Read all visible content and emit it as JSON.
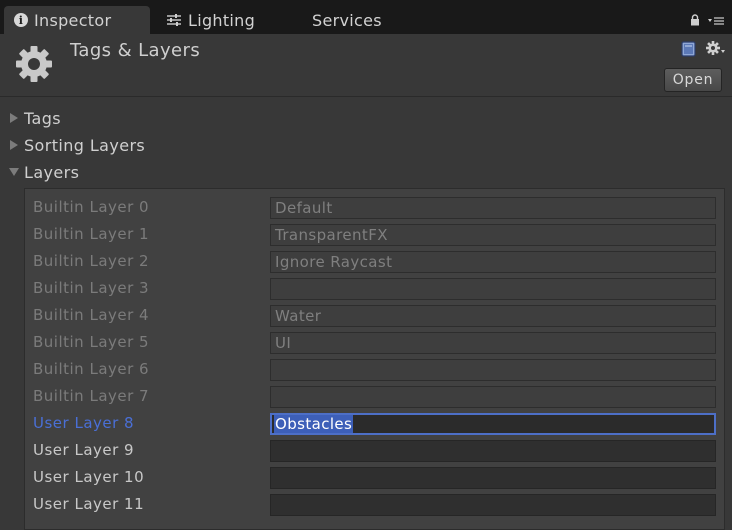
{
  "tabs": [
    {
      "label": "Inspector",
      "icon": "info-icon",
      "active": true
    },
    {
      "label": "Lighting",
      "icon": "sliders-icon",
      "active": false
    },
    {
      "label": "Services",
      "icon": "",
      "active": false
    }
  ],
  "header": {
    "title": "Tags & Layers",
    "open_label": "Open"
  },
  "foldouts": {
    "tags": "Tags",
    "sorting_layers": "Sorting Layers",
    "layers": "Layers"
  },
  "layers": [
    {
      "label": "Builtin Layer 0",
      "value": "Default",
      "kind": "builtin"
    },
    {
      "label": "Builtin Layer 1",
      "value": "TransparentFX",
      "kind": "builtin"
    },
    {
      "label": "Builtin Layer 2",
      "value": "Ignore Raycast",
      "kind": "builtin"
    },
    {
      "label": "Builtin Layer 3",
      "value": "",
      "kind": "builtin"
    },
    {
      "label": "Builtin Layer 4",
      "value": "Water",
      "kind": "builtin"
    },
    {
      "label": "Builtin Layer 5",
      "value": "UI",
      "kind": "builtin"
    },
    {
      "label": "Builtin Layer 6",
      "value": "",
      "kind": "builtin"
    },
    {
      "label": "Builtin Layer 7",
      "value": "",
      "kind": "builtin"
    },
    {
      "label": "User Layer 8",
      "value": "Obstacles",
      "kind": "focus"
    },
    {
      "label": "User Layer 9",
      "value": "",
      "kind": "user"
    },
    {
      "label": "User Layer 10",
      "value": "",
      "kind": "user"
    },
    {
      "label": "User Layer 11",
      "value": "",
      "kind": "user"
    }
  ],
  "colors": {
    "focus_accent": "#4d6fc7",
    "panel_bg": "#383838",
    "tabbar_bg": "#191919"
  }
}
